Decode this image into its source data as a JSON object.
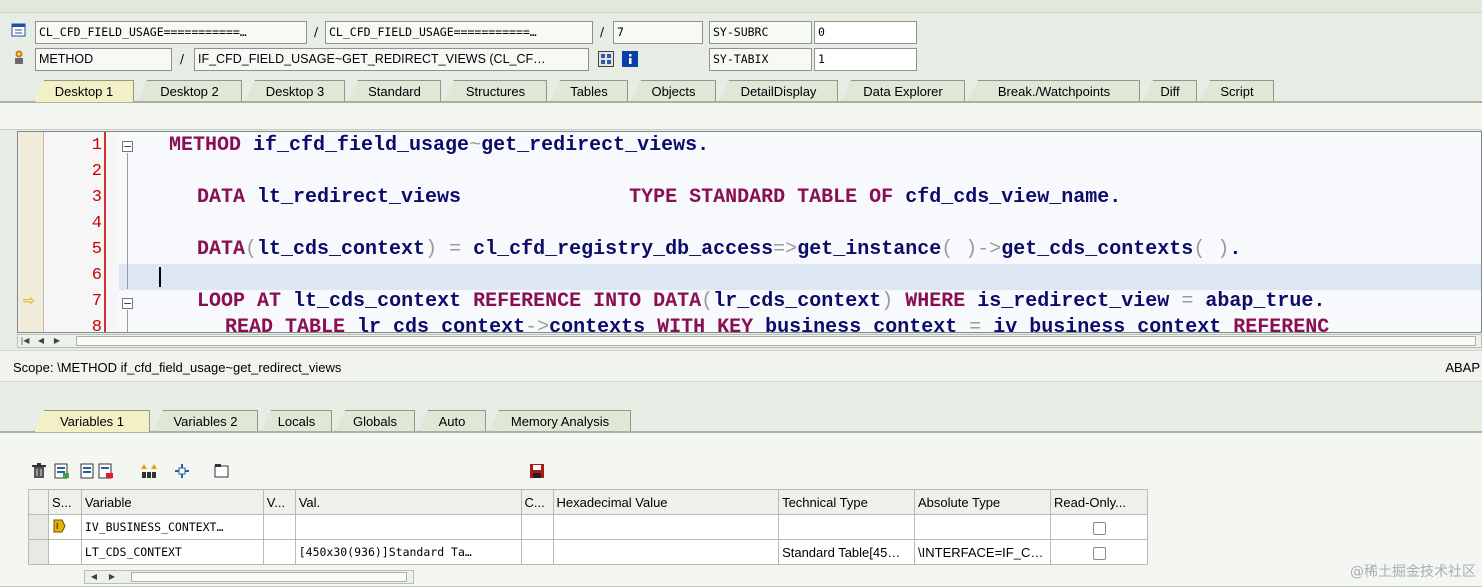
{
  "header_fields": {
    "program": "CL_CFD_FIELD_USAGE===========…",
    "include": "CL_CFD_FIELD_USAGE===========…",
    "line": "7",
    "sy_subrc_label": "SY-SUBRC",
    "sy_subrc_value": "0",
    "event_type": "METHOD",
    "event": "IF_CFD_FIELD_USAGE~GET_REDIRECT_VIEWS (CL_CF…",
    "sy_tabix_label": "SY-TABIX",
    "sy_tabix_value": "1",
    "separator": "/"
  },
  "desktop_tabs": [
    "Desktop 1",
    "Desktop 2",
    "Desktop 3",
    "Standard",
    "Structures",
    "Tables",
    "Objects",
    "DetailDisplay",
    "Data Explorer",
    "Break./Watchpoints",
    "Diff",
    "Script"
  ],
  "code_lines": [
    {
      "num": "1",
      "text": "METHOD if_cfd_field_usage~get_redirect_views."
    },
    {
      "num": "2",
      "text": ""
    },
    {
      "num": "3",
      "text": "DATA lt_redirect_views              TYPE STANDARD TABLE OF cfd_cds_view_name."
    },
    {
      "num": "4",
      "text": ""
    },
    {
      "num": "5",
      "text": "DATA(lt_cds_context) = cl_cfd_registry_db_access=>get_instance( )->get_cds_contexts( )."
    },
    {
      "num": "6",
      "text": ""
    },
    {
      "num": "7",
      "text": "LOOP AT lt_cds_context REFERENCE INTO DATA(lr_cds_context) WHERE is_redirect_view = abap_true."
    },
    {
      "num": "8",
      "text": "READ TABLE lr_cds_context->contexts WITH KEY business_context = iv_business_context REFERENC"
    }
  ],
  "scope": {
    "text": "Scope: \\METHOD if_cfd_field_usage~get_redirect_views",
    "language": "ABAP"
  },
  "variable_tabs": [
    "Variables 1",
    "Variables 2",
    "Locals",
    "Globals",
    "Auto",
    "Memory Analysis"
  ],
  "grid": {
    "columns": [
      "S...",
      "Variable",
      "V...",
      "Val.",
      "C...",
      "Hexadecimal Value",
      "Technical Type",
      "Absolute Type",
      "Read-Only..."
    ],
    "rows": [
      {
        "variable": "IV_BUSINESS_CONTEXT…",
        "value": "",
        "technical_type": "",
        "absolute_type": ""
      },
      {
        "variable": "LT_CDS_CONTEXT",
        "value": "[450x30(936)]Standard Ta…",
        "technical_type": "Standard Table[45…",
        "absolute_type": "\\INTERFACE=IF_C…"
      }
    ]
  },
  "watermark": "@稀土掘金技术社区",
  "colors": {
    "keyword": "#8a0f52",
    "identifier": "#0b0b6b",
    "line_number": "#cc0000",
    "active_tab": "#f4f0c6"
  }
}
